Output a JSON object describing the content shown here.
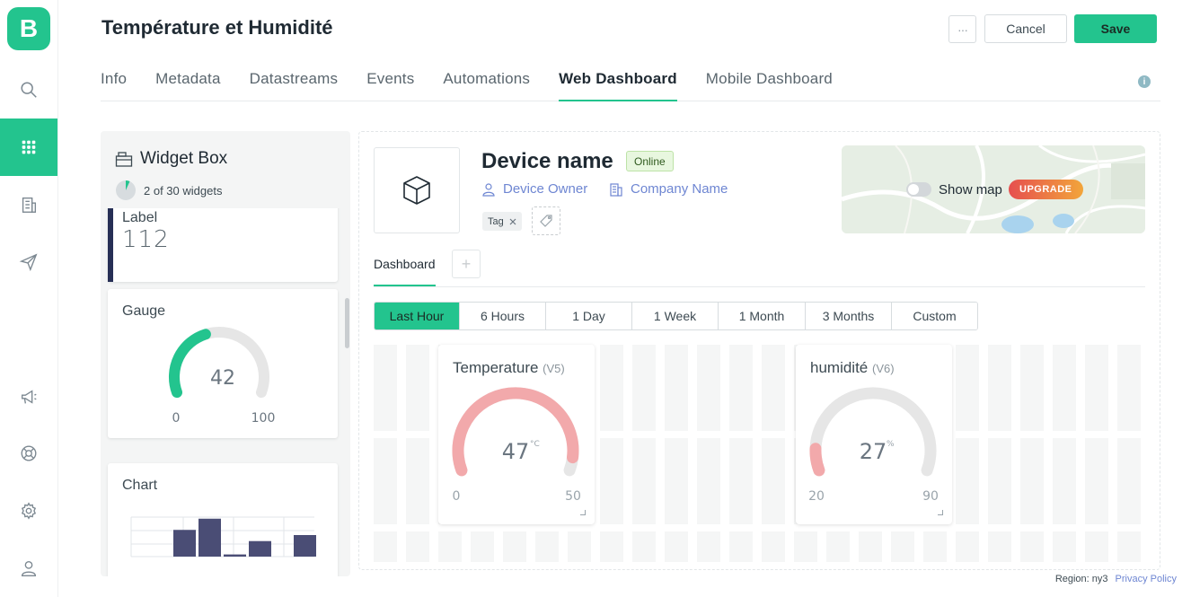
{
  "app": {
    "logo_letter": "B"
  },
  "header": {
    "title": "Température et Humidité",
    "more_label": "···",
    "cancel_label": "Cancel",
    "save_label": "Save"
  },
  "tabs": [
    {
      "label": "Info"
    },
    {
      "label": "Metadata"
    },
    {
      "label": "Datastreams"
    },
    {
      "label": "Events"
    },
    {
      "label": "Automations"
    },
    {
      "label": "Web Dashboard",
      "active": true
    },
    {
      "label": "Mobile Dashboard"
    }
  ],
  "info_icon": "i",
  "widget_box": {
    "title": "Widget Box",
    "count": "2 of 30 widgets",
    "count_fraction": 0.0667,
    "widgets": {
      "label": {
        "name": "Label",
        "value": "112"
      },
      "gauge": {
        "name": "Gauge",
        "value": "42",
        "min": "0",
        "max": "100",
        "level": 0.42
      },
      "chart": {
        "name": "Chart",
        "bars": [
          0,
          0.62,
          0.88,
          0.05,
          0.36,
          0,
          0.5
        ]
      }
    }
  },
  "device": {
    "name": "Device name",
    "status": "Online",
    "owner": "Device Owner",
    "company": "Company Name",
    "tag": "Tag",
    "show_map": "Show map",
    "upgrade": "UPGRADE"
  },
  "dashboard": {
    "tab": "Dashboard",
    "add_label": "+",
    "ranges": [
      {
        "label": "Last Hour",
        "active": true
      },
      {
        "label": "6 Hours"
      },
      {
        "label": "1 Day"
      },
      {
        "label": "1 Week"
      },
      {
        "label": "1 Month"
      },
      {
        "label": "3 Months"
      },
      {
        "label": "Custom"
      }
    ],
    "gauges": [
      {
        "title": "Temperature",
        "pin": "(V5)",
        "value": "47",
        "unit": "°C",
        "min": "0",
        "max": "50",
        "level": 0.94,
        "color": "#f2a9ab"
      },
      {
        "title": "humidité",
        "pin": "(V6)",
        "value": "27",
        "unit": "%",
        "min": "20",
        "max": "90",
        "level": 0.1,
        "color": "#f2a9ab"
      }
    ]
  },
  "footer": {
    "region": "Region: ny3",
    "privacy": "Privacy Policy"
  },
  "colors": {
    "brand": "#23c48e",
    "link": "#6e86d2",
    "gauge_track": "#e6e6e6",
    "label_bar": "#262f55",
    "chart_bar": "#4a4d75"
  },
  "icons": [
    "search-icon",
    "apps-grid-icon",
    "building-icon",
    "send-icon",
    "megaphone-icon",
    "lifebuoy-icon",
    "gear-icon",
    "user-icon",
    "cube-icon",
    "tag-icon",
    "widget-box-icon"
  ]
}
